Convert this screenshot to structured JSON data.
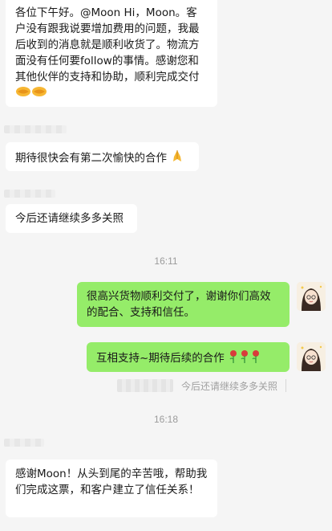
{
  "messages": {
    "m1": "各位下午好。@Moon Hi，Moon。客户没有跟我说要增加费用的问题，我最后收到的消息就是顺利收货了。物流方面没有任何要follow的事情。感谢您和其他伙伴的支持和协助，顺利完成交付",
    "m2": "期待很快会有第二次愉快的合作",
    "m3": "今后还请继续多多关照",
    "m4": "很高兴货物顺利交付了，谢谢你们高效的配合、支持和信任。",
    "m5": "互相支持~期待后续的合作",
    "m5_quote": "今后还请继续多多关照",
    "m6": "感谢Moon！从头到尾的辛苦哦，帮助我们完成这票，和客户建立了信任关系！"
  },
  "timestamps": {
    "t1": "16:11",
    "t2": "16:18"
  },
  "icons": {
    "handshake": "handshake-icon",
    "pray": "folded-hands-icon",
    "rose": "rose-icon"
  },
  "colors": {
    "incoming_bubble": "#ffffff",
    "outgoing_bubble": "#95ec69",
    "background": "#f5f5f5"
  }
}
